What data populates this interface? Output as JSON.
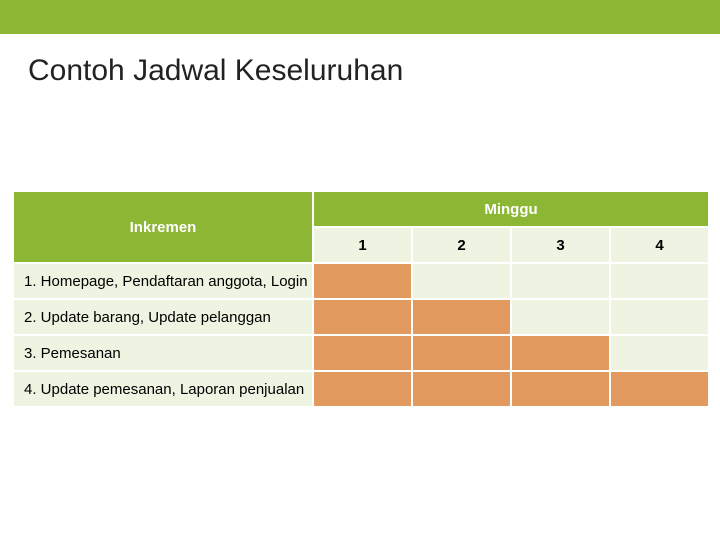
{
  "title": "Contoh Jadwal Keseluruhan",
  "headers": {
    "increment": "Inkremen",
    "week": "Minggu",
    "weeks": [
      "1",
      "2",
      "3",
      "4"
    ]
  },
  "rows": [
    {
      "label": "1.  Homepage, Pendaftaran anggota, Login",
      "shaded": [
        true,
        false,
        false,
        false
      ]
    },
    {
      "label": "2.  Update barang, Update pelanggan",
      "shaded": [
        true,
        true,
        false,
        false
      ]
    },
    {
      "label": "3.  Pemesanan",
      "shaded": [
        true,
        true,
        true,
        false
      ]
    },
    {
      "label": "4.  Update pemesanan, Laporan penjualan",
      "shaded": [
        true,
        true,
        true,
        true
      ]
    }
  ],
  "chart_data": {
    "type": "table",
    "title": "Contoh Jadwal Keseluruhan",
    "xlabel": "Minggu",
    "ylabel": "Inkremen",
    "categories": [
      "1",
      "2",
      "3",
      "4"
    ],
    "series": [
      {
        "name": "1.  Homepage, Pendaftaran anggota, Login",
        "values": [
          1,
          0,
          0,
          0
        ]
      },
      {
        "name": "2.  Update barang, Update pelanggan",
        "values": [
          1,
          1,
          0,
          0
        ]
      },
      {
        "name": "3.  Pemesanan",
        "values": [
          1,
          1,
          1,
          0
        ]
      },
      {
        "name": "4.  Update pemesanan, Laporan penjualan",
        "values": [
          1,
          1,
          1,
          1
        ]
      }
    ]
  }
}
